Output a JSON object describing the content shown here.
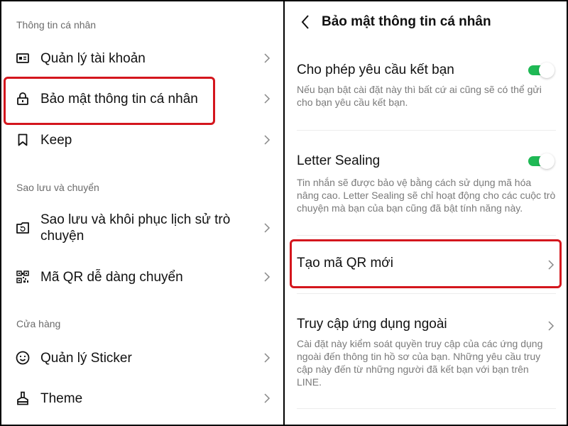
{
  "left_panel": {
    "sections": [
      {
        "label": "Thông tin cá nhân",
        "items": [
          {
            "label": "Quản lý tài khoản",
            "icon": "id-card-icon"
          },
          {
            "label": "Bảo mật thông tin cá nhân",
            "icon": "lock-icon",
            "highlighted": true
          },
          {
            "label": "Keep",
            "icon": "bookmark-icon"
          }
        ]
      },
      {
        "label": "Sao lưu và chuyển",
        "items": [
          {
            "label": "Sao lưu và khôi phục lịch sử trò chuyện",
            "icon": "folder-sync-icon"
          },
          {
            "label": "Mã QR dễ dàng chuyển",
            "icon": "qr-code-icon"
          }
        ]
      },
      {
        "label": "Cửa hàng",
        "items": [
          {
            "label": "Quản lý Sticker",
            "icon": "smiley-icon"
          },
          {
            "label": "Theme",
            "icon": "paint-brush-icon"
          }
        ]
      }
    ]
  },
  "right_panel": {
    "header": {
      "title": "Bảo mật thông tin cá nhân",
      "back_icon": "chevron-left-icon"
    },
    "settings": [
      {
        "title": "Cho phép yêu cầu kết bạn",
        "description": "Nếu bạn bật cài đặt này thì bất cứ ai cũng sẽ có thể gửi cho bạn yêu cầu kết bạn.",
        "control": "toggle",
        "enabled": true
      },
      {
        "title": "Letter Sealing",
        "description": "Tin nhắn sẽ được bảo vệ bằng cách sử dụng mã hóa nâng cao. Letter Sealing sẽ chỉ hoạt động cho các cuộc trò chuyện mà bạn của bạn cũng đã bật tính năng này.",
        "control": "toggle",
        "enabled": true
      },
      {
        "title": "Tạo mã QR mới",
        "control": "chevron",
        "highlighted": true
      },
      {
        "title": "Truy cập ứng dụng ngoài",
        "description": "Cài đặt này kiểm soát quyền truy cập của các ứng dụng ngoài đến thông tin hồ sơ của bạn. Những yêu cầu truy cập này đến từ những người đã kết bạn với bạn trên LINE.",
        "control": "chevron"
      }
    ]
  },
  "colors": {
    "highlight": "#d4161d",
    "toggle_on": "#1fb955",
    "section_label": "#6b6b6b",
    "description": "#7a7a7a"
  }
}
